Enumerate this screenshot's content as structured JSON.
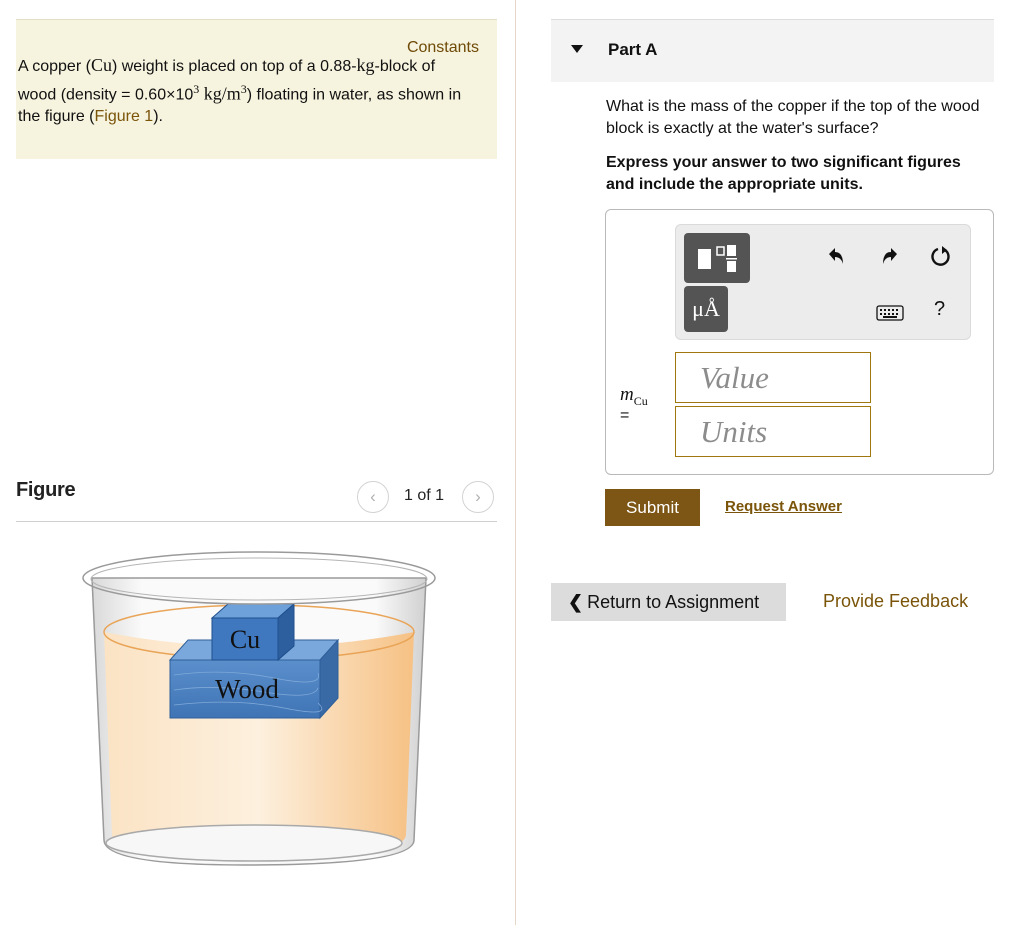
{
  "problem": {
    "constants_link": "Constants",
    "text_1": "A copper (",
    "cu_symbol": "Cu",
    "text_2": ") weight is placed on top of a 0.88-",
    "kg_unit": "kg",
    "text_3": "-block of wood (density = 0.60",
    "density_value": "×10",
    "density_exp": "3",
    "density_unit_a": " kg/m",
    "density_unit_exp": "3",
    "text_4": ") floating in water, as shown in the figure (",
    "figure_link": "Figure 1",
    "text_5": ")."
  },
  "figure": {
    "title": "Figure",
    "count": "1 of 1",
    "prev_icon": "chevron-left-icon",
    "next_icon": "chevron-right-icon",
    "label_cu": "Cu",
    "label_wood": "Wood",
    "colors": {
      "water": "#f8c990",
      "block": "#4a80c0",
      "glass": "#e8e8e8"
    }
  },
  "part": {
    "title": "Part A",
    "question": "What is the mass of the copper if the top of the wood block is exactly at the water's surface?",
    "instruction": "Express your answer to two significant figures and include the appropriate units.",
    "toolbar": {
      "units_button": "μÅ",
      "undo_icon": "undo-icon",
      "redo_icon": "redo-icon",
      "reset_icon": "reset-icon",
      "keyboard_icon": "keyboard-icon",
      "help": "?"
    },
    "variable": "m",
    "variable_sub": "Cu",
    "equals": "=",
    "value_placeholder": "Value",
    "units_placeholder": "Units",
    "submit": "Submit",
    "request_answer": "Request Answer"
  },
  "footer": {
    "return": "Return to Assignment",
    "feedback": "Provide Feedback"
  },
  "colors": {
    "accent": "#7d5514",
    "link": "#7a5409",
    "constants_bg": "#f6f3de"
  }
}
